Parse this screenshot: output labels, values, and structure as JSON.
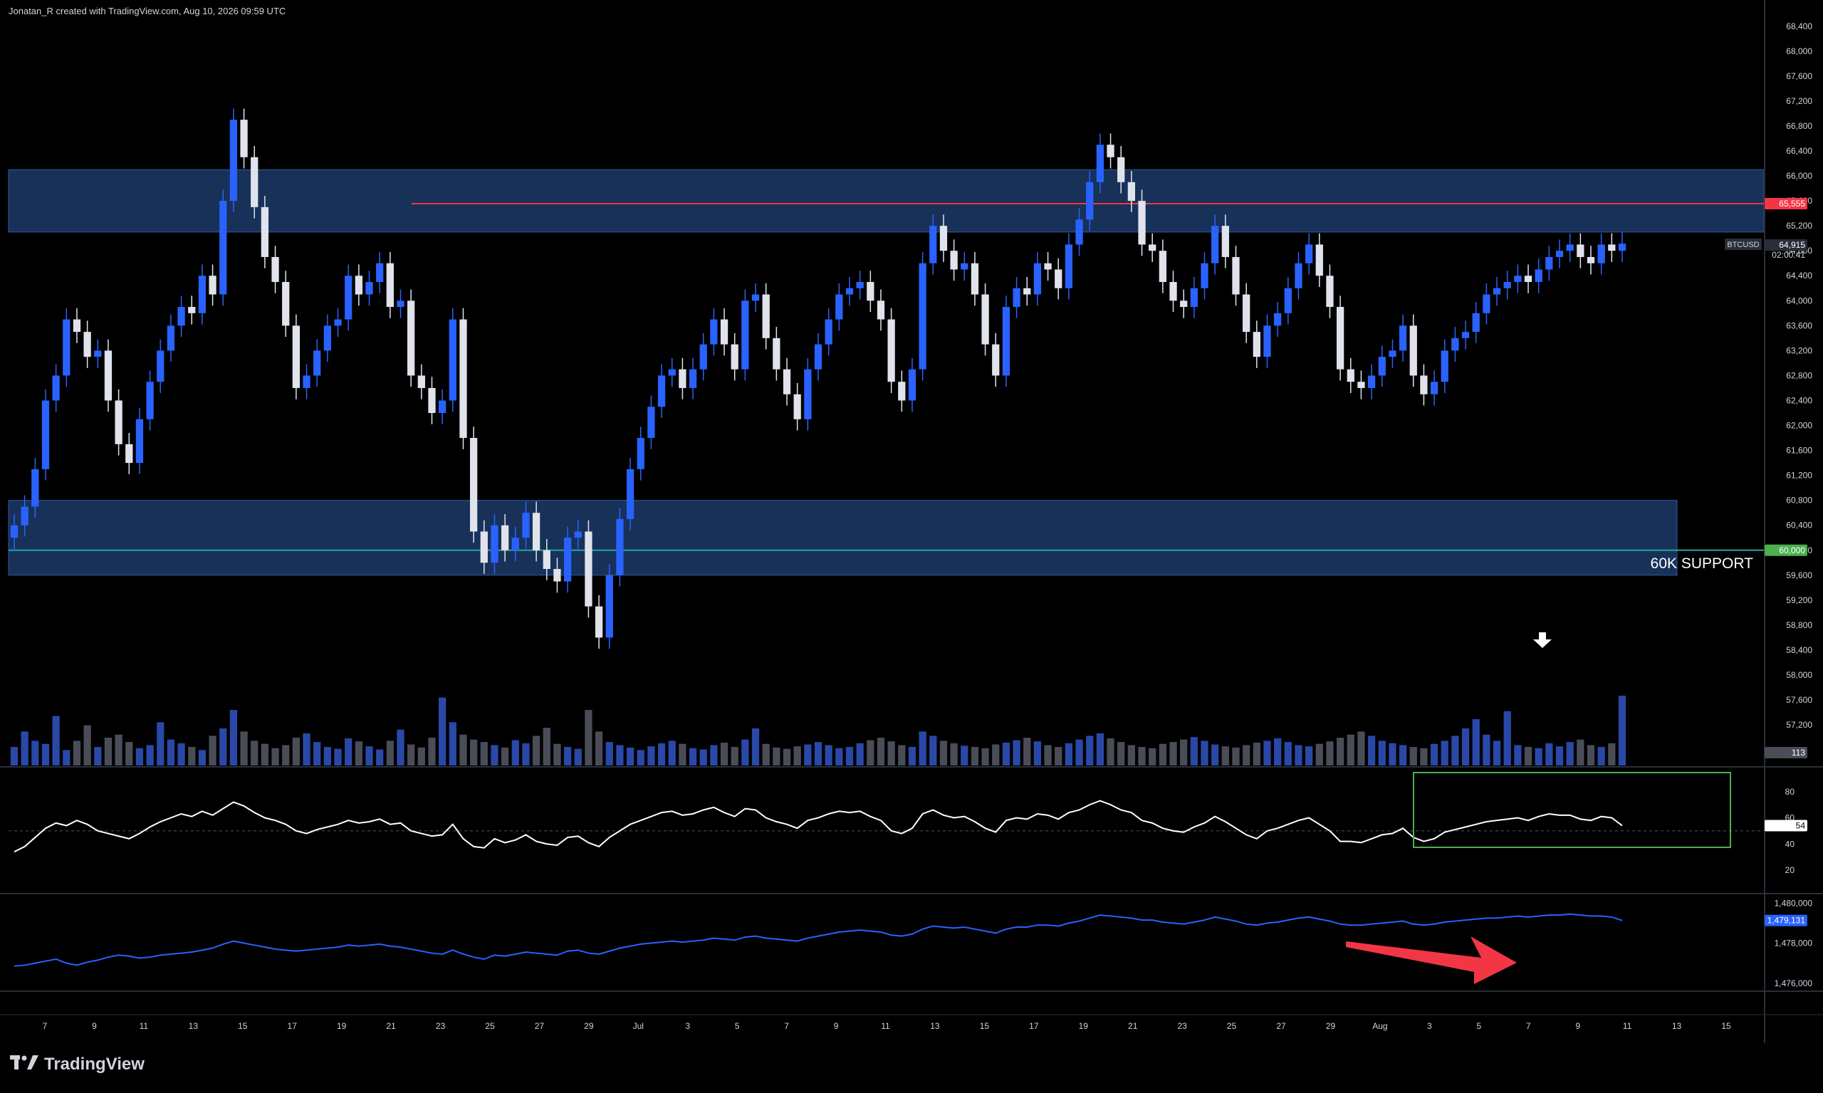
{
  "attribution": "Jonatan_R created with TradingView.com, Aug 10, 2026 09:59 UTC",
  "brand": "TradingView",
  "colors": {
    "background": "#000000",
    "up_candle": "#2962ff",
    "down_candle": "#e0e3eb",
    "zone_fill": "#1c3a68",
    "resistance_line": "#f23645",
    "support_line": "#26a69a",
    "rsi_line": "#ffffff",
    "obv_line": "#2962ff",
    "arrow_red": "#f23645",
    "rsi_box": "#4caf50"
  },
  "icons": {
    "volume_marker": "down-arrow-icon",
    "trend_arrow": "red-arrow-icon",
    "logo": "tradingview-logo-icon"
  },
  "chart_data": {
    "type": "candlestick",
    "symbol": "BTCUSD",
    "price_axis": {
      "ticks": [
        "68,400",
        "68,000",
        "67,600",
        "67,200",
        "66,800",
        "66,400",
        "66,000",
        "65,600",
        "65,200",
        "64,800",
        "64,400",
        "64,000",
        "63,600",
        "63,200",
        "62,800",
        "62,400",
        "62,000",
        "61,600",
        "61,200",
        "60,800",
        "60,400",
        "60,000",
        "59,600",
        "59,200",
        "58,800",
        "58,400",
        "58,000",
        "57,600",
        "57,200"
      ],
      "range": [
        56950,
        68500
      ]
    },
    "x_axis": {
      "labels": [
        "7",
        "9",
        "11",
        "13",
        "15",
        "17",
        "19",
        "21",
        "23",
        "25",
        "27",
        "29",
        "Jul",
        "3",
        "5",
        "7",
        "9",
        "11",
        "13",
        "15",
        "17",
        "19",
        "21",
        "23",
        "25",
        "27",
        "29",
        "Aug",
        "3",
        "5",
        "7",
        "9",
        "11",
        "13",
        "15"
      ]
    },
    "price_labels": {
      "resistance": "65,555",
      "last_price": "64,915",
      "countdown": "02:00:41",
      "support": "60,000",
      "volume": "113"
    },
    "zones": [
      {
        "name": "upper-resistance-zone",
        "from": 65100,
        "to": 66100
      },
      {
        "name": "lower-support-zone",
        "from": 59600,
        "to": 60800
      }
    ],
    "levels": [
      {
        "name": "resistance",
        "value": 65555
      },
      {
        "name": "support",
        "value": 60000,
        "label": "60K SUPPORT"
      }
    ],
    "closes": [
      60400,
      60700,
      61300,
      62400,
      62800,
      63700,
      63500,
      63100,
      63200,
      62400,
      61700,
      61400,
      62100,
      62700,
      63200,
      63600,
      63900,
      63800,
      64400,
      64100,
      65600,
      66900,
      66300,
      65500,
      64700,
      64300,
      63600,
      62600,
      62800,
      63200,
      63600,
      63700,
      64400,
      64100,
      64300,
      64600,
      63900,
      64000,
      62800,
      62600,
      62200,
      62400,
      63700,
      61800,
      60300,
      59800,
      60400,
      60000,
      60200,
      60600,
      60000,
      59700,
      59500,
      60200,
      60300,
      59100,
      58600,
      59600,
      60500,
      61300,
      61800,
      62300,
      62800,
      62900,
      62600,
      62900,
      63300,
      63700,
      63300,
      62900,
      64000,
      64100,
      63400,
      62900,
      62500,
      62100,
      62900,
      63300,
      63700,
      64100,
      64200,
      64300,
      64000,
      63700,
      62700,
      62400,
      62900,
      64600,
      65200,
      64800,
      64500,
      64600,
      64100,
      63300,
      62800,
      63900,
      64200,
      64100,
      64600,
      64500,
      64200,
      64900,
      65300,
      65900,
      66500,
      66300,
      65900,
      65600,
      64900,
      64800,
      64300,
      64000,
      63900,
      64200,
      64600,
      65200,
      64700,
      64100,
      63500,
      63100,
      63600,
      63800,
      64200,
      64600,
      64900,
      64400,
      63900,
      62900,
      62700,
      62600,
      62800,
      63100,
      63200,
      63600,
      62800,
      62500,
      62700,
      63200,
      63400,
      63500,
      63800,
      64100,
      64200,
      64300,
      64400,
      64300,
      64500,
      64700,
      64800,
      64900,
      64700,
      64600,
      64900,
      64800,
      64915
    ],
    "volumes": [
      30,
      55,
      40,
      35,
      80,
      25,
      40,
      65,
      30,
      45,
      50,
      38,
      28,
      33,
      70,
      42,
      36,
      30,
      25,
      48,
      60,
      90,
      55,
      40,
      35,
      28,
      33,
      45,
      52,
      38,
      30,
      27,
      44,
      39,
      31,
      26,
      40,
      58,
      34,
      29,
      45,
      110,
      70,
      50,
      42,
      38,
      33,
      29,
      41,
      36,
      48,
      61,
      35,
      30,
      27,
      90,
      55,
      38,
      33,
      29,
      25,
      31,
      36,
      40,
      35,
      28,
      26,
      33,
      37,
      30,
      42,
      60,
      35,
      29,
      27,
      31,
      34,
      38,
      33,
      28,
      30,
      36,
      41,
      45,
      39,
      33,
      30,
      55,
      48,
      40,
      36,
      32,
      30,
      28,
      34,
      37,
      41,
      45,
      39,
      33,
      30,
      36,
      42,
      48,
      52,
      44,
      38,
      33,
      30,
      28,
      35,
      38,
      42,
      46,
      40,
      34,
      31,
      29,
      33,
      37,
      40,
      44,
      38,
      33,
      31,
      35,
      39,
      45,
      50,
      55,
      48,
      40,
      36,
      33,
      30,
      28,
      35,
      40,
      48,
      60,
      75,
      50,
      40,
      88,
      33,
      30,
      28,
      36,
      31,
      38,
      42,
      33,
      30,
      36,
      113
    ],
    "rsi": {
      "ticks": [
        "80",
        "60",
        "40",
        "20"
      ],
      "current": "54",
      "midline": 50,
      "values": [
        34,
        38,
        45,
        52,
        56,
        54,
        58,
        55,
        50,
        48,
        46,
        44,
        48,
        53,
        57,
        60,
        63,
        61,
        65,
        62,
        67,
        72,
        69,
        64,
        60,
        58,
        55,
        50,
        48,
        51,
        53,
        55,
        58,
        56,
        57,
        59,
        55,
        56,
        50,
        48,
        46,
        47,
        55,
        44,
        38,
        37,
        44,
        41,
        43,
        47,
        42,
        40,
        39,
        45,
        46,
        41,
        38,
        45,
        50,
        55,
        58,
        61,
        64,
        65,
        62,
        63,
        66,
        68,
        64,
        61,
        67,
        66,
        60,
        57,
        55,
        52,
        58,
        60,
        63,
        65,
        64,
        65,
        61,
        58,
        50,
        48,
        52,
        63,
        66,
        62,
        60,
        61,
        57,
        52,
        49,
        58,
        60,
        59,
        63,
        62,
        59,
        64,
        66,
        70,
        73,
        70,
        66,
        64,
        58,
        56,
        52,
        50,
        49,
        53,
        56,
        61,
        57,
        52,
        47,
        44,
        50,
        52,
        55,
        58,
        60,
        55,
        50,
        42,
        42,
        41,
        44,
        47,
        48,
        52,
        45,
        42,
        44,
        49,
        51,
        53,
        55,
        57,
        58,
        59,
        60,
        58,
        61,
        63,
        62,
        62,
        59,
        58,
        61,
        60,
        54
      ]
    },
    "obv": {
      "ticks": [
        "1,480,000",
        "1,478,000",
        "1,476,000"
      ],
      "current": "1,479,131",
      "values": [
        1476850,
        1476900,
        1477000,
        1477100,
        1477200,
        1477000,
        1476900,
        1477050,
        1477150,
        1477300,
        1477400,
        1477350,
        1477250,
        1477300,
        1477400,
        1477450,
        1477500,
        1477550,
        1477650,
        1477750,
        1477950,
        1478100,
        1478000,
        1477900,
        1477800,
        1477700,
        1477650,
        1477600,
        1477650,
        1477700,
        1477750,
        1477800,
        1477900,
        1477850,
        1477900,
        1477950,
        1477850,
        1477800,
        1477700,
        1477600,
        1477500,
        1477450,
        1477650,
        1477450,
        1477300,
        1477200,
        1477400,
        1477350,
        1477450,
        1477550,
        1477500,
        1477450,
        1477400,
        1477600,
        1477650,
        1477500,
        1477450,
        1477600,
        1477750,
        1477850,
        1477950,
        1478000,
        1478050,
        1478100,
        1478050,
        1478100,
        1478150,
        1478250,
        1478200,
        1478150,
        1478300,
        1478350,
        1478250,
        1478200,
        1478150,
        1478100,
        1478250,
        1478350,
        1478450,
        1478550,
        1478600,
        1478650,
        1478600,
        1478550,
        1478400,
        1478350,
        1478450,
        1478700,
        1478850,
        1478800,
        1478750,
        1478800,
        1478700,
        1478600,
        1478500,
        1478700,
        1478800,
        1478800,
        1478900,
        1478900,
        1478850,
        1479000,
        1479100,
        1479250,
        1479400,
        1479350,
        1479300,
        1479250,
        1479150,
        1479150,
        1479050,
        1479000,
        1478950,
        1479050,
        1479150,
        1479300,
        1479200,
        1479100,
        1478950,
        1478900,
        1479000,
        1479050,
        1479150,
        1479250,
        1479300,
        1479200,
        1479100,
        1478950,
        1478900,
        1478900,
        1478950,
        1479000,
        1479050,
        1479100,
        1478950,
        1478900,
        1478950,
        1479050,
        1479100,
        1479150,
        1479200,
        1479250,
        1479250,
        1479300,
        1479350,
        1479300,
        1479350,
        1479400,
        1479400,
        1479450,
        1479400,
        1479350,
        1479350,
        1479300,
        1479131
      ],
      "range": [
        1475600,
        1480400
      ]
    }
  }
}
